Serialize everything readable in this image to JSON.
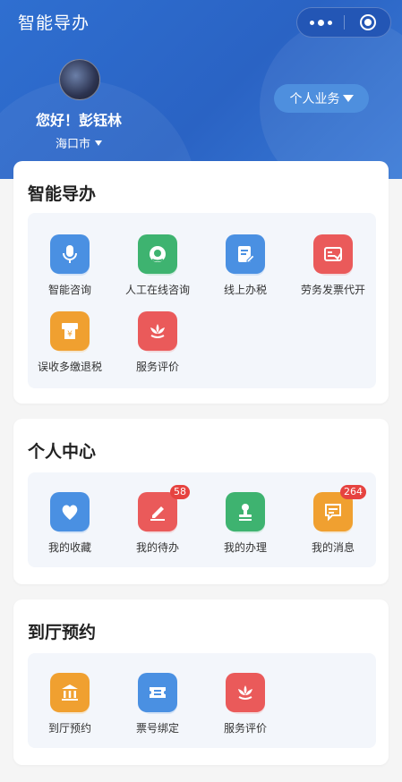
{
  "app": {
    "title": "智能导办"
  },
  "header": {
    "greeting": "您好！彭钰林",
    "city": "海口市",
    "business_button": "个人业务"
  },
  "colors": {
    "primary": "#2f6fd0",
    "blue_icon": "#4a90e2",
    "green_icon": "#3eb370",
    "red_icon": "#ea5a5a",
    "orange_icon": "#f0a030",
    "badge": "#e64340"
  },
  "sections": {
    "guide": {
      "title": "智能导办",
      "items": [
        {
          "label": "智能咨询",
          "icon": "microphone-icon"
        },
        {
          "label": "人工在线咨询",
          "icon": "headset-icon"
        },
        {
          "label": "线上办税",
          "icon": "document-edit-icon"
        },
        {
          "label": "劳务发票代开",
          "icon": "invoice-icon"
        },
        {
          "label": "误收多缴退税",
          "icon": "refund-yen-icon"
        },
        {
          "label": "服务评价",
          "icon": "lotus-icon"
        }
      ]
    },
    "personal": {
      "title": "个人中心",
      "items": [
        {
          "label": "我的收藏",
          "icon": "heart-icon",
          "badge": ""
        },
        {
          "label": "我的待办",
          "icon": "pen-icon",
          "badge": "58"
        },
        {
          "label": "我的办理",
          "icon": "stamp-icon",
          "badge": ""
        },
        {
          "label": "我的消息",
          "icon": "message-icon",
          "badge": "264"
        }
      ]
    },
    "appointment": {
      "title": "到厅预约",
      "items": [
        {
          "label": "到厅预约",
          "icon": "hall-building-icon"
        },
        {
          "label": "票号绑定",
          "icon": "ticket-icon"
        },
        {
          "label": "服务评价",
          "icon": "lotus-icon"
        }
      ]
    }
  }
}
